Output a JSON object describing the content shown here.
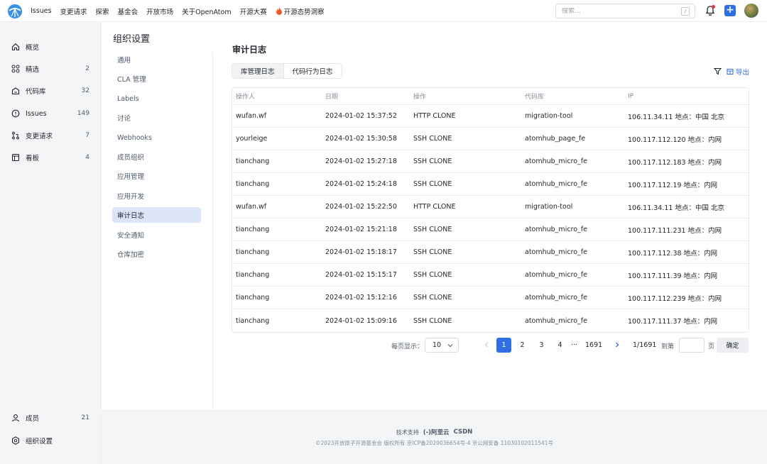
{
  "topnav": {
    "items": [
      "Issues",
      "变更请求",
      "探索",
      "基金会",
      "开放市场",
      "关于OpenAtom",
      "开源大赛",
      "开源态势洞察"
    ],
    "search_placeholder": "搜索...",
    "search_shortcut": "/",
    "plus": "+"
  },
  "sidebar": {
    "items": [
      {
        "label": "概览",
        "count": "",
        "icon": "home-icon"
      },
      {
        "label": "精选",
        "count": "2",
        "icon": "grid-icon"
      },
      {
        "label": "代码库",
        "count": "32",
        "icon": "repo-icon"
      },
      {
        "label": "Issues",
        "count": "149",
        "icon": "issue-icon"
      },
      {
        "label": "变更请求",
        "count": "7",
        "icon": "pull-request-icon"
      },
      {
        "label": "看板",
        "count": "4",
        "icon": "board-icon"
      }
    ],
    "bottom": [
      {
        "label": "成员",
        "count": "21",
        "icon": "user-icon"
      },
      {
        "label": "组织设置",
        "count": "",
        "icon": "settings-icon"
      }
    ]
  },
  "settings_nav": {
    "title": "组织设置",
    "items": [
      "通用",
      "CLA 管理",
      "Labels",
      "讨论",
      "Webhooks",
      "成员组织",
      "应用管理",
      "应用开发",
      "审计日志",
      "安全通知",
      "仓库加密"
    ],
    "active_index": 8
  },
  "main": {
    "title": "审计日志",
    "tabs": [
      "库管理日志",
      "代码行为日志"
    ],
    "export": "导出"
  },
  "table": {
    "headers": [
      "操作人",
      "日期",
      "操作",
      "代码库",
      "IP"
    ],
    "rows": [
      [
        "wufan.wf",
        "2024-01-02 15:37:52",
        "HTTP CLONE",
        "migration-tool",
        "106.11.34.11 地点：中国 北京"
      ],
      [
        "yourleige",
        "2024-01-02 15:30:58",
        "SSH CLONE",
        "atomhub_page_fe",
        "100.117.112.120 地点：内网"
      ],
      [
        "tianchang",
        "2024-01-02 15:27:18",
        "SSH CLONE",
        "atomhub_micro_fe",
        "100.117.112.183 地点：内网"
      ],
      [
        "tianchang",
        "2024-01-02 15:24:18",
        "SSH CLONE",
        "atomhub_micro_fe",
        "100.117.112.19 地点：内网"
      ],
      [
        "wufan.wf",
        "2024-01-02 15:22:50",
        "HTTP CLONE",
        "migration-tool",
        "106.11.34.11 地点：中国 北京"
      ],
      [
        "tianchang",
        "2024-01-02 15:21:18",
        "SSH CLONE",
        "atomhub_micro_fe",
        "100.117.111.231 地点：内网"
      ],
      [
        "tianchang",
        "2024-01-02 15:18:17",
        "SSH CLONE",
        "atomhub_micro_fe",
        "100.117.112.38 地点：内网"
      ],
      [
        "tianchang",
        "2024-01-02 15:15:17",
        "SSH CLONE",
        "atomhub_micro_fe",
        "100.117.111.39 地点：内网"
      ],
      [
        "tianchang",
        "2024-01-02 15:12:16",
        "SSH CLONE",
        "atomhub_micro_fe",
        "100.117.112.239 地点：内网"
      ],
      [
        "tianchang",
        "2024-01-02 15:09:16",
        "SSH CLONE",
        "atomhub_micro_fe",
        "100.117.111.37 地点：内网"
      ]
    ]
  },
  "pagination": {
    "page_size_label": "每页显示：",
    "page_size": "10",
    "pages": [
      "1",
      "2",
      "3",
      "4",
      "···",
      "1691"
    ],
    "current": "1",
    "total": "1/1691",
    "jump_label": "到第",
    "page_suffix": "页",
    "confirm": "确定"
  },
  "footer": {
    "support_label": "技术支持",
    "brands": [
      "(-)阿里云",
      "CSDN"
    ],
    "copyright": "©2023开放原子开源基金会 版权所有  京ICP备2020036654号-4  京公网安备 11030102011541号"
  },
  "colors": {
    "accent": "#2f6fe4",
    "active_bg": "#dde6f9",
    "sidebar_bg": "#f4f5f7"
  }
}
